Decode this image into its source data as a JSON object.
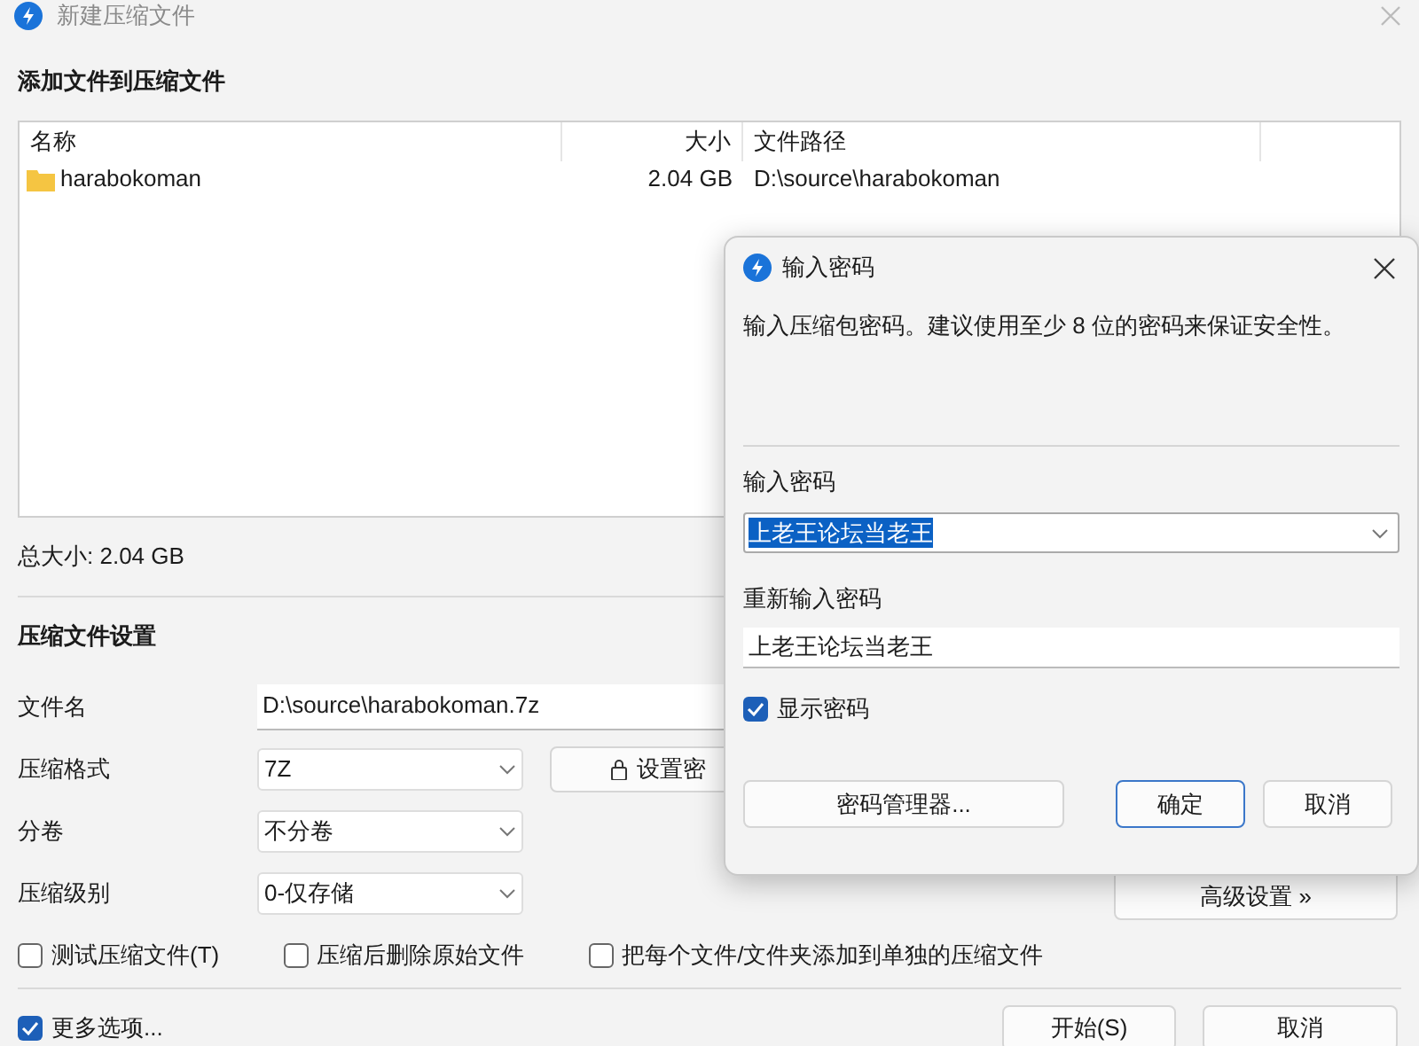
{
  "window": {
    "title": "新建压缩文件"
  },
  "files_section": {
    "heading": "添加文件到压缩文件",
    "columns": [
      "名称",
      "大小",
      "文件路径"
    ],
    "rows": [
      {
        "name": "harabokoman",
        "size": "2.04 GB",
        "path": "D:\\source\\harabokoman"
      }
    ],
    "total": "总大小: 2.04 GB"
  },
  "settings": {
    "heading": "压缩文件设置",
    "fields": [
      {
        "kind": "text",
        "label": "文件名",
        "value": "D:\\source\\harabokoman.7z"
      },
      {
        "kind": "select",
        "label": "压缩格式",
        "value": "7Z"
      },
      {
        "kind": "select",
        "label": "分卷",
        "value": "不分卷"
      },
      {
        "kind": "select",
        "label": "压缩级别",
        "value": "0-仅存储"
      }
    ],
    "set_password_button": "设置密",
    "advanced_button": "高级设置 »"
  },
  "options": [
    {
      "label": "测试压缩文件(T)",
      "checked": false
    },
    {
      "label": "压缩后删除原始文件",
      "checked": false
    },
    {
      "label": "把每个文件/文件夹添加到单独的压缩文件",
      "checked": false
    }
  ],
  "more_options": {
    "label": "更多选项...",
    "checked": true
  },
  "buttons": [
    "开始(S)",
    "取消"
  ],
  "password_dialog": {
    "title": "输入密码",
    "message": "输入压缩包密码。建议使用至少 8 位的密码来保证安全性。",
    "password_label": "输入密码",
    "password_value": "上老王论坛当老王",
    "password_text_selected": true,
    "confirm_label": "重新输入密码",
    "confirm_value": "上老王论坛当老王",
    "show_password": {
      "label": "显示密码",
      "checked": true
    },
    "buttons": [
      {
        "label": "密码管理器...",
        "default": false
      },
      {
        "label": "确定",
        "default": true
      },
      {
        "label": "取消",
        "default": false
      }
    ]
  }
}
